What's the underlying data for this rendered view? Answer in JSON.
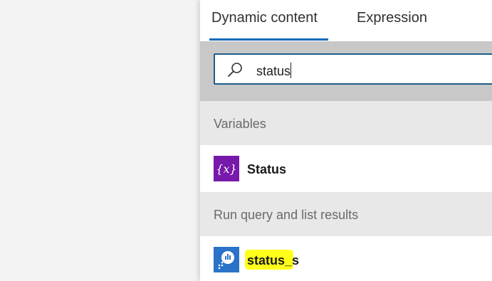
{
  "tabs": {
    "dynamic_content": "Dynamic content",
    "expression": "Expression"
  },
  "search": {
    "value": "status",
    "icon": "search-icon"
  },
  "sections": [
    {
      "header": "Variables",
      "items": [
        {
          "label": "Status",
          "icon": "variable-icon",
          "icon_glyph": "{x}",
          "icon_color": "#7719aa"
        }
      ]
    },
    {
      "header": "Run query and list results",
      "items": [
        {
          "label": "status_s",
          "icon": "log-analytics-icon",
          "icon_color": "#2b72c9",
          "highlight_color": "#ffff1a"
        }
      ]
    }
  ],
  "colors": {
    "accent": "#0f6cbd",
    "panel_background": "#ffffff",
    "canvas_background": "#f3f3f3",
    "section_background": "#e8e8e8"
  }
}
